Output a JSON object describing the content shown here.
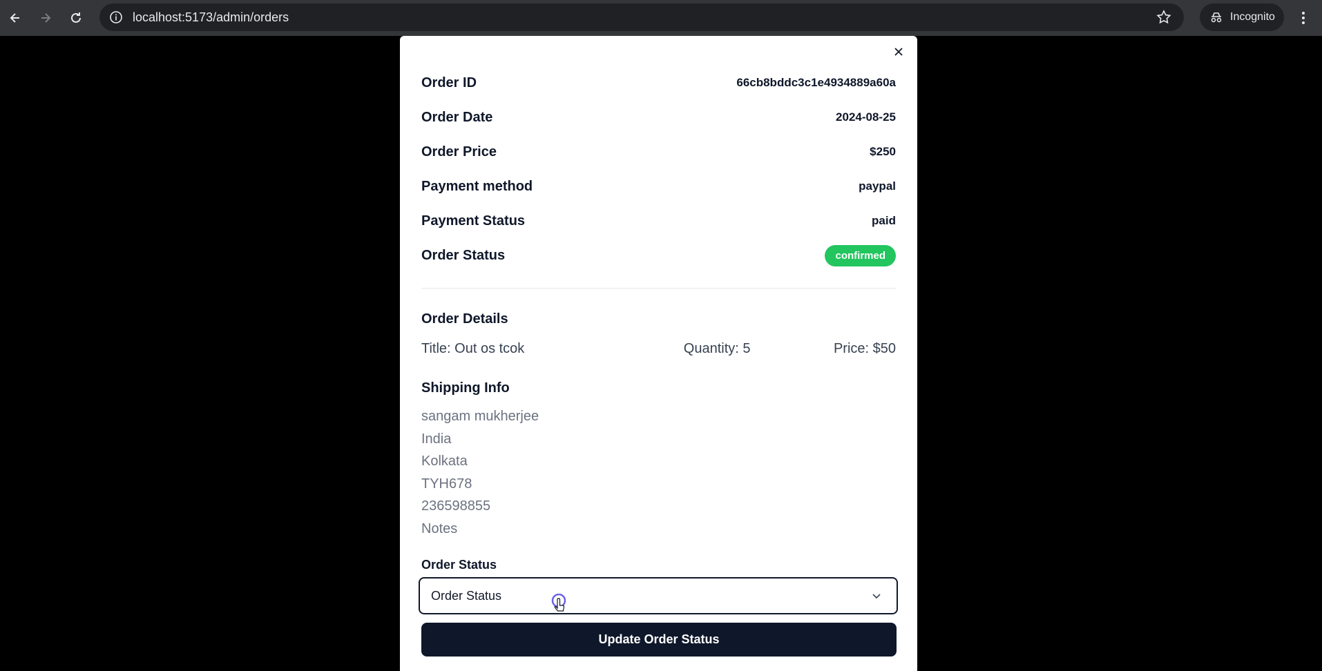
{
  "browser": {
    "url": "localhost:5173/admin/orders",
    "incognito_label": "Incognito"
  },
  "order": {
    "rows": [
      {
        "label": "Order ID",
        "value": "66cb8bddc3c1e4934889a60a"
      },
      {
        "label": "Order Date",
        "value": "2024-08-25"
      },
      {
        "label": "Order Price",
        "value": "$250"
      },
      {
        "label": "Payment method",
        "value": "paypal"
      },
      {
        "label": "Payment Status",
        "value": "paid"
      }
    ],
    "status_label": "Order Status",
    "status_value": "confirmed",
    "status_color": "#22c55e"
  },
  "details": {
    "title": "Order Details",
    "item": {
      "title": "Title: Out os tcok",
      "quantity": "Quantity: 5",
      "price": "Price: $50"
    }
  },
  "shipping": {
    "title": "Shipping Info",
    "lines": [
      "sangam mukherjee",
      "India",
      "Kolkata",
      "TYH678",
      "236598855",
      "Notes"
    ]
  },
  "form": {
    "label": "Order Status",
    "select_value": "Order Status",
    "submit_label": "Update Order Status",
    "button_color": "#0f172a"
  }
}
